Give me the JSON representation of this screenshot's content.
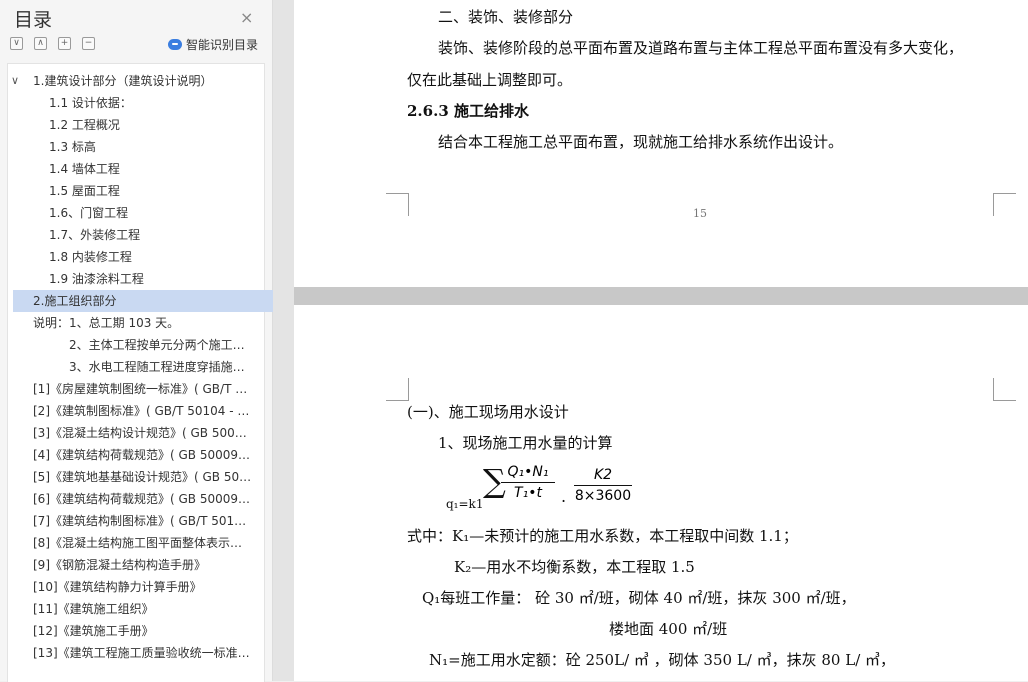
{
  "sidebar": {
    "title": "目录",
    "close_icon": "×",
    "tools": [
      "∨",
      "∧",
      "+",
      "−"
    ],
    "smart_label": "智能识别目录",
    "toc": [
      {
        "label": "1.建筑设计部分（建筑设计说明）"
      },
      {
        "label": "1.1 设计依据："
      },
      {
        "label": "1.2 工程概况"
      },
      {
        "label": "1.3 标高"
      },
      {
        "label": "1.4 墙体工程"
      },
      {
        "label": "1.5 屋面工程"
      },
      {
        "label": "1.6、门窗工程"
      },
      {
        "label": "1.7、外装修工程"
      },
      {
        "label": "1.8 内装修工程"
      },
      {
        "label": "1.9 油漆涂料工程"
      },
      {
        "label": "2.施工组织部分"
      },
      {
        "label": "说明：1、总工期 103 天。"
      },
      {
        "label": "2、主体工程按单元分两个施工…"
      },
      {
        "label": "3、水电工程随工程进度穿插施…"
      },
      {
        "label": "[1]《房屋建筑制图统一标准》( GB/T …"
      },
      {
        "label": "[2]《建筑制图标准》( GB/T 50104 - 2…"
      },
      {
        "label": "[3]《混凝土结构设计规范》( GB 5001…"
      },
      {
        "label": "[4]《建筑结构荷载规范》( GB 50009…"
      },
      {
        "label": "[5]《建筑地基基础设计规范》( GB 50…"
      },
      {
        "label": "[6]《建筑结构荷载规范》( GB 50009…"
      },
      {
        "label": "[7]《建筑结构制图标准》( GB/T 5010…"
      },
      {
        "label": "[8]《混凝土结构施工图平面整体表示…"
      },
      {
        "label": "[9]《钢筋混凝土结构构造手册》"
      },
      {
        "label": "[10]《建筑结构静力计算手册》"
      },
      {
        "label": "[11]《建筑施工组织》"
      },
      {
        "label": "[12]《建筑施工手册》"
      },
      {
        "label": "[13]《建筑工程施工质量验收统一标准…"
      }
    ]
  },
  "page1": {
    "line1": "二、装饰、装修部分",
    "line2": "装饰、装修阶段的总平面布置及道路布置与主体工程总平面布置没有多大变化，",
    "line3": "仅在此基础上调整即可。",
    "heading": "2.6.3  施工给排水",
    "line4": "结合本工程施工总平面布置，现就施工给排水系统作出设计。",
    "page_number": "15"
  },
  "page2": {
    "section": "(一)、施工现场用水设计",
    "sub": "1、现场施工用水量的计算",
    "formula": {
      "lhs": "q₁=k1",
      "sum": "∑",
      "num1": "Q₁•N₁",
      "den1": "T₁•t",
      "dot": ".",
      "num2": "K2",
      "den2": "8×3600"
    },
    "line1": "式中：K₁—未预计的施工用水系数，本工程取中间数 1.1；",
    "line2": "K₂—用水不均衡系数，本工程取 1.5",
    "line3": "Q₁每班工作量：   砼 30 ㎡/班，砌体 40 ㎡/班，抹灰 300 ㎡/班，",
    "line4": "楼地面 400 ㎡/班",
    "line5": "N₁=施工用水定额：砼 250L/ ㎥ ，砌体 350 L/ ㎥，抹灰 80 L/ ㎥，"
  }
}
